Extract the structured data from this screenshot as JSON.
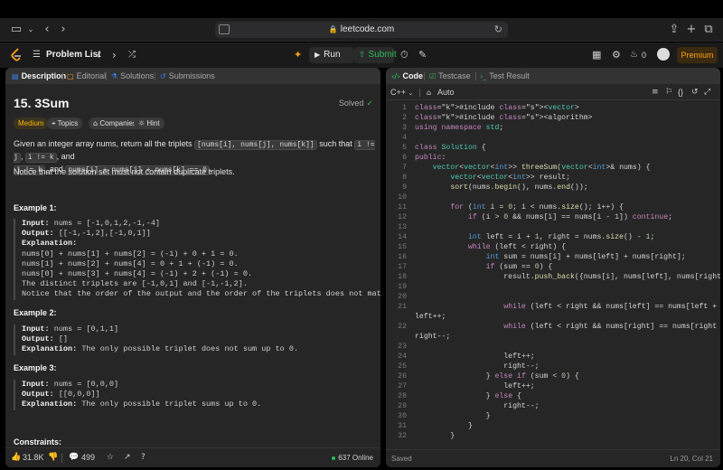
{
  "browser": {
    "url": "leetcode.com"
  },
  "topnav": {
    "problem_list": "Problem List",
    "run": "Run",
    "submit": "Submit",
    "streak": "0",
    "premium": "Premium"
  },
  "left_tabs": [
    "Description",
    "Editorial",
    "Solutions",
    "Submissions"
  ],
  "problem": {
    "title": "15. 3Sum",
    "status": "Solved",
    "difficulty": "Medium",
    "chips": [
      "Topics",
      "Companies",
      "Hint"
    ],
    "desc1": "Given an integer array nums, return all the triplets",
    "code_a": "[nums[i], nums[j], nums[k]]",
    "desc2": "such that",
    "code_b": "i != j",
    "code_c": "i != k",
    "desc3": ", and",
    "code_d": "j != k",
    "desc4": ", and",
    "code_e": "nums[i] + nums[j] + nums[k] == 0",
    "note": "Notice that the solution set must not contain duplicate triplets."
  },
  "examples": [
    {
      "title": "Example 1:",
      "input": "nums = [-1,0,1,2,-1,-4]",
      "output": "[[-1,-1,2],[-1,0,1]]",
      "explanation_lines": [
        "nums[0] + nums[1] + nums[2] = (-1) + 0 + 1 = 0.",
        "nums[1] + nums[2] + nums[4] = 0 + 1 + (-1) = 0.",
        "nums[0] + nums[3] + nums[4] = (-1) + 2 + (-1) = 0.",
        "The distinct triplets are [-1,0,1] and [-1,-1,2].",
        "Notice that the order of the output and the order of the triplets does not matter."
      ]
    },
    {
      "title": "Example 2:",
      "input": "nums = [0,1,1]",
      "output": "[]",
      "explanation": "The only possible triplet does not sum up to 0."
    },
    {
      "title": "Example 3:",
      "input": "nums = [0,0,0]",
      "output": "[[0,0,0]]",
      "explanation": "The only possible triplet sums up to 0."
    }
  ],
  "labels": {
    "input": "Input:",
    "output": "Output:",
    "explanation": "Explanation:"
  },
  "constraints_title": "Constraints:",
  "footer": {
    "likes": "31.8K",
    "comments": "499",
    "online": "637 Online"
  },
  "right_tabs": [
    "Code",
    "Testcase",
    "Test Result"
  ],
  "editor": {
    "language": "C++",
    "mode": "Auto",
    "status": "Saved",
    "cursor": "Ln 20, Col 21"
  },
  "code_lines": [
    "#include <vector>",
    "#include <algorithm>",
    "using namespace std;",
    "",
    "class Solution {",
    "public:",
    "    vector<vector<int>> threeSum(vector<int>& nums) {",
    "        vector<vector<int>> result;",
    "        sort(nums.begin(), nums.end());",
    "",
    "        for (int i = 0; i < nums.size(); i++) {",
    "            if (i > 0 && nums[i] == nums[i - 1]) continue;",
    "",
    "            int left = i + 1, right = nums.size() - 1;",
    "            while (left < right) {",
    "                int sum = nums[i] + nums[left] + nums[right];",
    "                if (sum == 0) {",
    "                    result.push_back({nums[i], nums[left], nums[right]});",
    "",
    "",
    "                    while (left < right && nums[left] == nums[left + 1])",
    "left++;",
    "                    while (left < right && nums[right] == nums[right - 1])",
    "right--;",
    "",
    "                    left++;",
    "                    right--;",
    "                } else if (sum < 0) {",
    "                    left++;",
    "                } else {",
    "                    right--;",
    "                }",
    "            }",
    "        }"
  ],
  "code_line_numbers": [
    "1",
    "2",
    "3",
    "4",
    "5",
    "6",
    "7",
    "8",
    "9",
    "10",
    "11",
    "12",
    "13",
    "14",
    "15",
    "16",
    "17",
    "18",
    "19",
    "20",
    "21",
    "",
    "22",
    "",
    "23",
    "24",
    "25",
    "26",
    "27",
    "28",
    "29",
    "30",
    "31",
    "32"
  ]
}
